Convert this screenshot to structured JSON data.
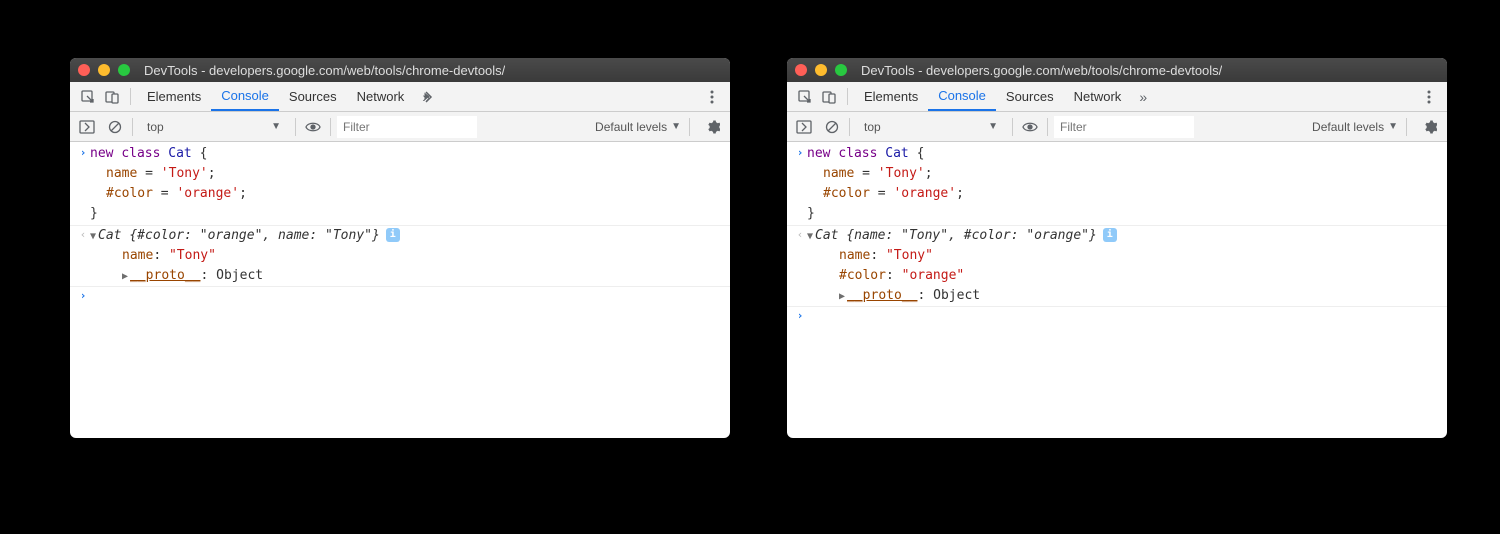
{
  "windows": [
    {
      "title": "DevTools - developers.google.com/web/tools/chrome-devtools/",
      "tabs": [
        "Elements",
        "Console",
        "Sources",
        "Network"
      ],
      "activeTab": "Console",
      "toolbar": {
        "context": "top",
        "filterPlaceholder": "Filter",
        "levels": "Default levels"
      },
      "input": {
        "line1": {
          "kw_new": "new",
          "kw_class": "class",
          "type": "Cat",
          "brace": " {"
        },
        "line2": {
          "prop": "name",
          "eq": " = ",
          "str": "'Tony'",
          "semi": ";"
        },
        "line3": {
          "prop": "#color",
          "eq": " = ",
          "str": "'orange'",
          "semi": ";"
        },
        "line4": {
          "brace": "}"
        }
      },
      "output": {
        "summary": {
          "type": "Cat",
          "body": " {#color: \"orange\", name: \"Tony\"}"
        },
        "rows": [
          {
            "key": "name",
            "val": "\"Tony\"",
            "isPrivate": false
          },
          {
            "key": "__proto__",
            "val": "Object",
            "isProto": true
          }
        ]
      }
    },
    {
      "title": "DevTools - developers.google.com/web/tools/chrome-devtools/",
      "tabs": [
        "Elements",
        "Console",
        "Sources",
        "Network"
      ],
      "activeTab": "Console",
      "toolbar": {
        "context": "top",
        "filterPlaceholder": "Filter",
        "levels": "Default levels"
      },
      "input": {
        "line1": {
          "kw_new": "new",
          "kw_class": "class",
          "type": "Cat",
          "brace": " {"
        },
        "line2": {
          "prop": "name",
          "eq": " = ",
          "str": "'Tony'",
          "semi": ";"
        },
        "line3": {
          "prop": "#color",
          "eq": " = ",
          "str": "'orange'",
          "semi": ";"
        },
        "line4": {
          "brace": "}"
        }
      },
      "output": {
        "summary": {
          "type": "Cat",
          "body": " {name: \"Tony\", #color: \"orange\"}"
        },
        "rows": [
          {
            "key": "name",
            "val": "\"Tony\"",
            "isPrivate": false
          },
          {
            "key": "#color",
            "val": "\"orange\"",
            "isPrivate": true
          },
          {
            "key": "__proto__",
            "val": "Object",
            "isProto": true
          }
        ]
      }
    }
  ]
}
